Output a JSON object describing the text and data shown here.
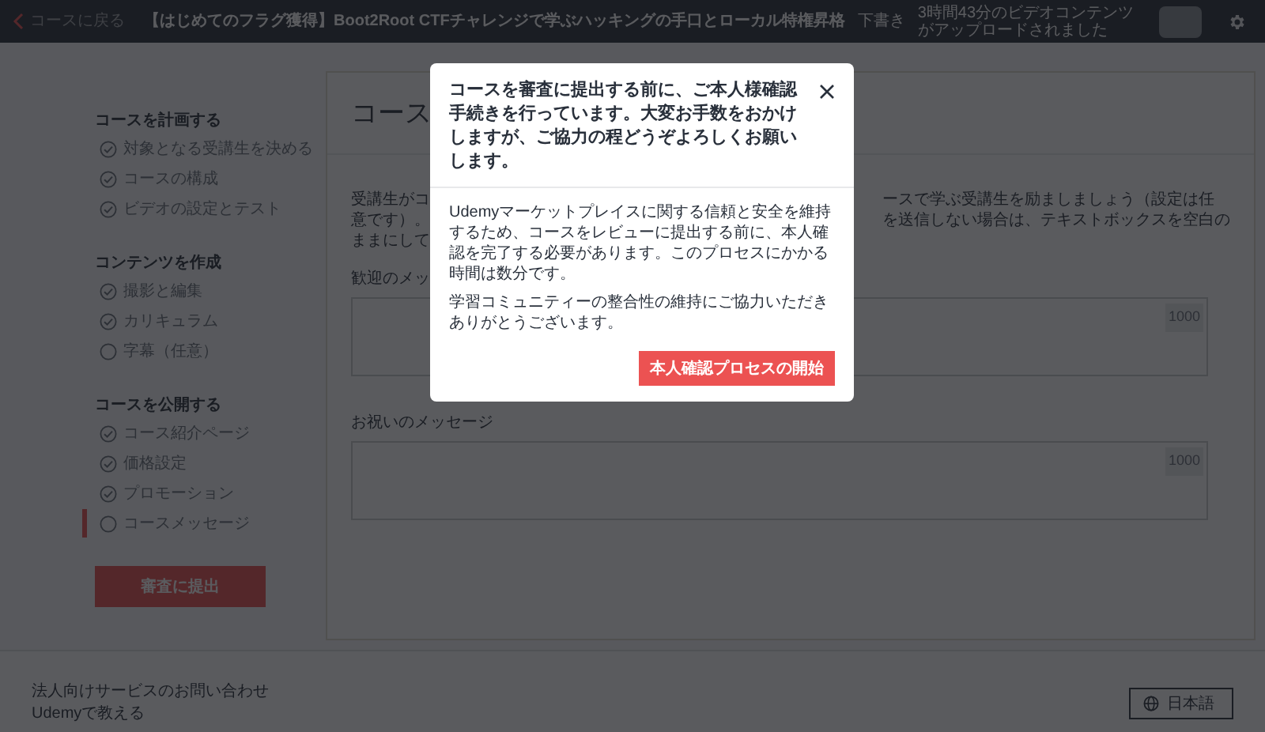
{
  "top_bar": {
    "back_link": "コースに戻る",
    "course_title": "【はじめてのフラグ獲得】Boot2Root CTFチャレンジで学ぶハッキングの手口とローカル特権昇格",
    "status_badge": "下書き",
    "upload_status": "3時間43分のビデオコンテンツがアップロードされました"
  },
  "sidebar": {
    "sections": [
      {
        "heading": "コースを計画する",
        "items": [
          {
            "label": "対象となる受講生を決める",
            "checked": true,
            "selected": false
          },
          {
            "label": "コースの構成",
            "checked": true,
            "selected": false
          },
          {
            "label": "ビデオの設定とテスト",
            "checked": true,
            "selected": false
          }
        ]
      },
      {
        "heading": "コンテンツを作成",
        "items": [
          {
            "label": "撮影と編集",
            "checked": true,
            "selected": false
          },
          {
            "label": "カリキュラム",
            "checked": true,
            "selected": false
          },
          {
            "label": "字幕（任意）",
            "checked": false,
            "selected": false
          }
        ]
      },
      {
        "heading": "コースを公開する",
        "items": [
          {
            "label": "コース紹介ページ",
            "checked": true,
            "selected": false
          },
          {
            "label": "価格設定",
            "checked": true,
            "selected": false
          },
          {
            "label": "プロモーション",
            "checked": true,
            "selected": false
          },
          {
            "label": "コースメッセージ",
            "checked": false,
            "selected": true
          }
        ]
      }
    ],
    "submit_button": "審査に提出"
  },
  "main_panel": {
    "title": "コース",
    "description_left": [
      "受講生がコ",
      "意です）。",
      "ままにして"
    ],
    "description_right": [
      "ースで学ぶ受講生を励ましましょう（設定は任",
      "を送信しない場合は、テキストボックスを空白の"
    ],
    "fields": [
      {
        "label": "歓迎のメッ",
        "counter": "1000"
      },
      {
        "label": "お祝いのメッセージ",
        "counter": "1000"
      }
    ]
  },
  "footer": {
    "links": [
      "法人向けサービスのお問い合わせ",
      "Udemyで教える"
    ],
    "language_button": "日本語"
  },
  "modal": {
    "title": "コースを審査に提出する前に、ご本人様確認手続きを行っています。大変お手数をおかけしますが、ご協力の程どうぞよろしくお願いします。",
    "paragraphs": [
      "Udemyマーケットプレイスに関する信頼と安全を維持するため、コースをレビューに提出する前に、本人確認を完了する必要があります。このプロセスにかかる時間は数分です。",
      "学習コミュニティーの整合性の維持にご協力いただきありがとうございます。"
    ],
    "primary_button": "本人確認プロセスの開始"
  }
}
